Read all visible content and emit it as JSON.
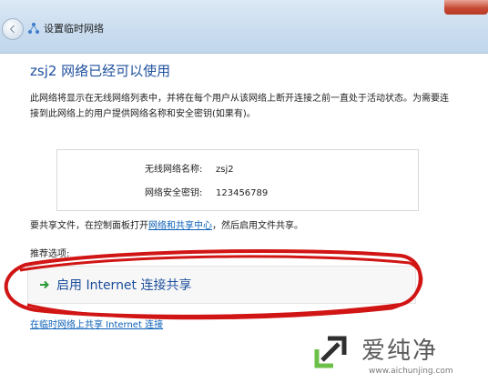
{
  "window": {
    "title": "设置临时网络"
  },
  "main": {
    "heading": "zsj2 网络已经可以使用",
    "description": "此网络将显示在无线网络列表中，并将在每个用户从该网络上断开连接之前一直处于活动状态。为需要连接到此网络上的用户提供网络名称和安全密钥(如果有)。",
    "network_name_label": "无线网络名称:",
    "network_name_value": "zsj2",
    "security_key_label": "网络安全密钥:",
    "security_key_value": "123456789",
    "share_prefix": "要共享文件，在控制面板打开",
    "share_link": "网络和共享中心",
    "share_suffix": "，然后启用文件共享。",
    "recommended_label": "推荐选项:",
    "option_label": "启用 Internet 连接共享",
    "bottom_link": "在临时网络上共享 Internet 连接"
  },
  "watermark": {
    "name": "爱纯净",
    "url": "www.aichunjing.com"
  },
  "icons": {
    "back": "back-arrow-icon",
    "network": "network-icon",
    "option_arrow": "green-arrow-icon",
    "logo": "aichunjing-logo"
  },
  "colors": {
    "heading": "#1e4f9c",
    "link": "#0b5fb8",
    "annotation": "#d11515",
    "arrow": "#2e9b3a"
  }
}
